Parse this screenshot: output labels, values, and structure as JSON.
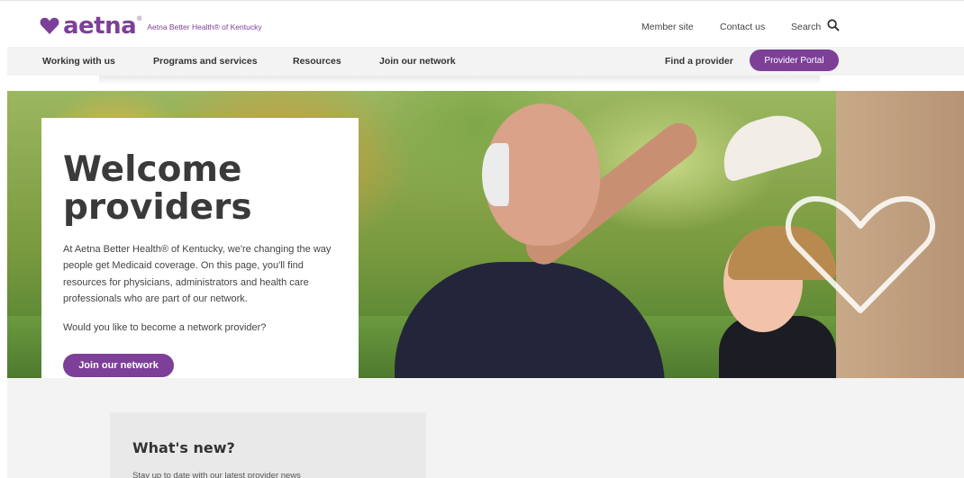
{
  "brand": {
    "logo_text": "aetna",
    "logo_reg": "®",
    "subtitle": "Aetna Better Health® of Kentucky",
    "color": "#7d3f98"
  },
  "utility_nav": {
    "member_site": "Member site",
    "contact_us": "Contact us",
    "search": "Search",
    "search_icon": "search-icon"
  },
  "main_nav": {
    "items": [
      "Working with us",
      "Programs and services",
      "Resources",
      "Join our network"
    ],
    "find_provider": "Find a provider",
    "portal_button": "Provider Portal"
  },
  "hero": {
    "title_line1": "Welcome",
    "title_line2": "providers",
    "body": "At Aetna Better Health® of Kentucky, we're changing the way people get Medicaid coverage. On this page, you'll find resources for physicians, administrators and health care professionals who are part of our network.",
    "question": "Would you like to become a network provider?",
    "cta": "Join our network"
  },
  "news": {
    "title": "What's new?",
    "subtitle": "Stay up to date with our latest provider news"
  }
}
